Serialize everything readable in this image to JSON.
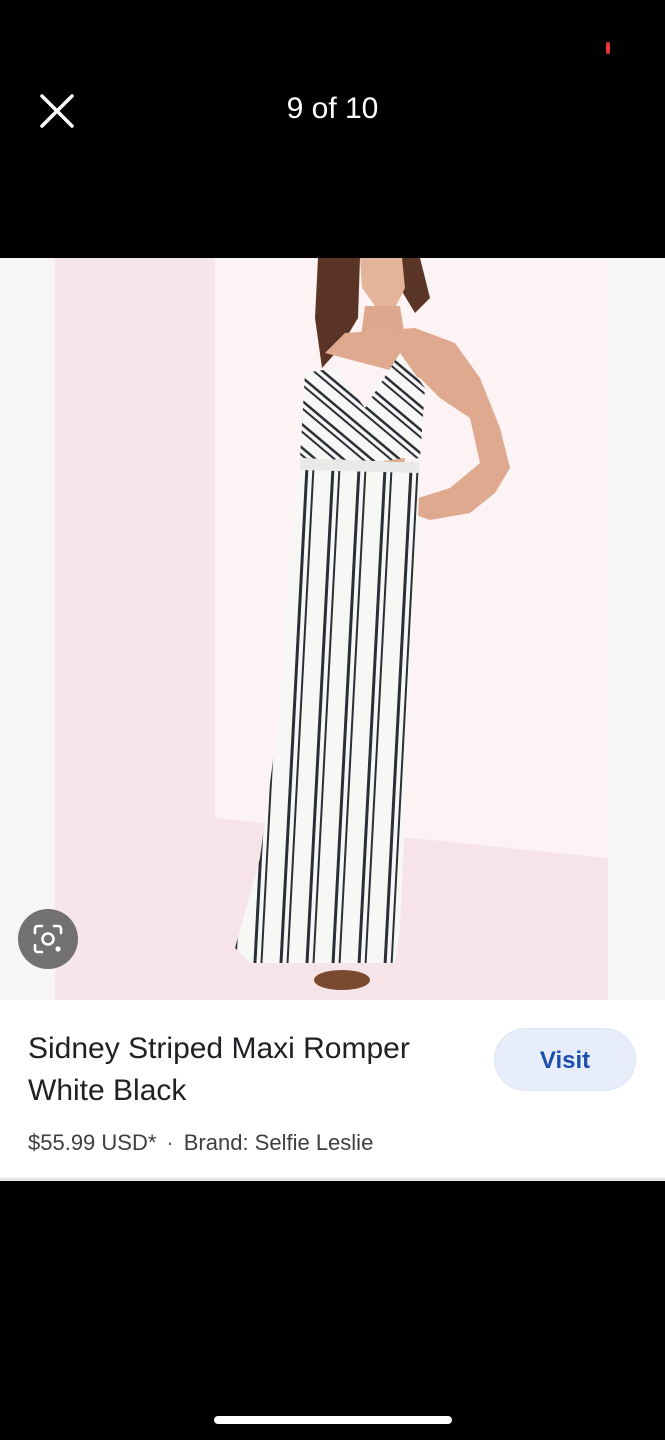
{
  "header": {
    "counter": "9 of 10",
    "close_icon": "close-icon"
  },
  "image": {
    "subject": "woman wearing striped maxi romper",
    "lens_icon": "lens-search-icon"
  },
  "product": {
    "title": "Sidney Striped Maxi Romper White Black",
    "price": "$55.99 USD*",
    "separator": "·",
    "brand": "Brand: Selfie Leslie",
    "visit_label": "Visit"
  },
  "colors": {
    "background": "#000000",
    "card": "#ffffff",
    "visit_bg": "#e8edfb",
    "visit_text": "#1a4fb0",
    "status_dot": "#e53935"
  }
}
